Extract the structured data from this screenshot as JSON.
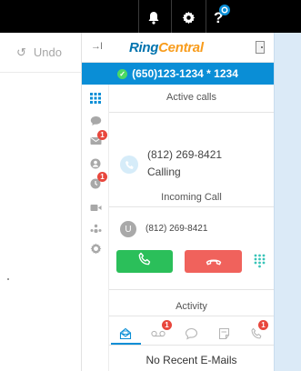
{
  "topbar": {
    "icons": [
      "bell-icon",
      "gear-icon",
      "help-icon"
    ]
  },
  "left": {
    "undo_label": "Undo",
    "undo_icon": "undo-icon"
  },
  "rc": {
    "logo_ring": "Ring",
    "logo_central": "Central",
    "number": "(650)123-1234 * 1234",
    "status_color": "#4cd964",
    "accent": "#0a8ed6",
    "nav": [
      {
        "icon": "keypad-icon",
        "badge": ""
      },
      {
        "icon": "chat-icon",
        "badge": ""
      },
      {
        "icon": "message-icon",
        "badge": "1"
      },
      {
        "icon": "contacts-icon",
        "badge": ""
      },
      {
        "icon": "call-history-icon",
        "badge": "1"
      },
      {
        "icon": "video-icon",
        "badge": ""
      },
      {
        "icon": "conference-icon",
        "badge": ""
      },
      {
        "icon": "settings-icon",
        "badge": ""
      }
    ],
    "active_calls": {
      "title": "Active calls",
      "number": "(812) 269-8421",
      "status": "Calling"
    },
    "incoming": {
      "title": "Incoming Call",
      "avatar_letter": "U",
      "number": "(812) 269-8421",
      "answer_color": "#2bbf5a",
      "decline_color": "#f0625c"
    },
    "activity": {
      "title": "Activity",
      "tabs": [
        {
          "icon": "email-tab-icon",
          "badge": ""
        },
        {
          "icon": "voicemail-tab-icon",
          "badge": "1"
        },
        {
          "icon": "sms-tab-icon",
          "badge": ""
        },
        {
          "icon": "fax-tab-icon",
          "badge": ""
        },
        {
          "icon": "calls-tab-icon",
          "badge": "1"
        }
      ],
      "empty_text": "No Recent E-Mails"
    }
  }
}
